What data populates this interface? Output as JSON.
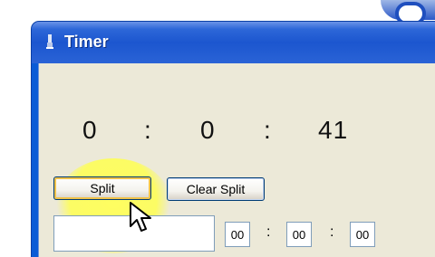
{
  "window": {
    "title": "Timer"
  },
  "timer": {
    "hours": "0",
    "minutes": "0",
    "seconds": "41",
    "separator": ":"
  },
  "buttons": {
    "split": "Split",
    "clear_split": "Clear Split"
  },
  "split_fields": [
    "00",
    "00",
    "00"
  ],
  "icons": [
    "timer-app-icon",
    "mouse-pointer-icon"
  ],
  "colors": {
    "titlebar": "#2456d3",
    "client": "#ece9d8",
    "highlight": "#ffff5a"
  }
}
